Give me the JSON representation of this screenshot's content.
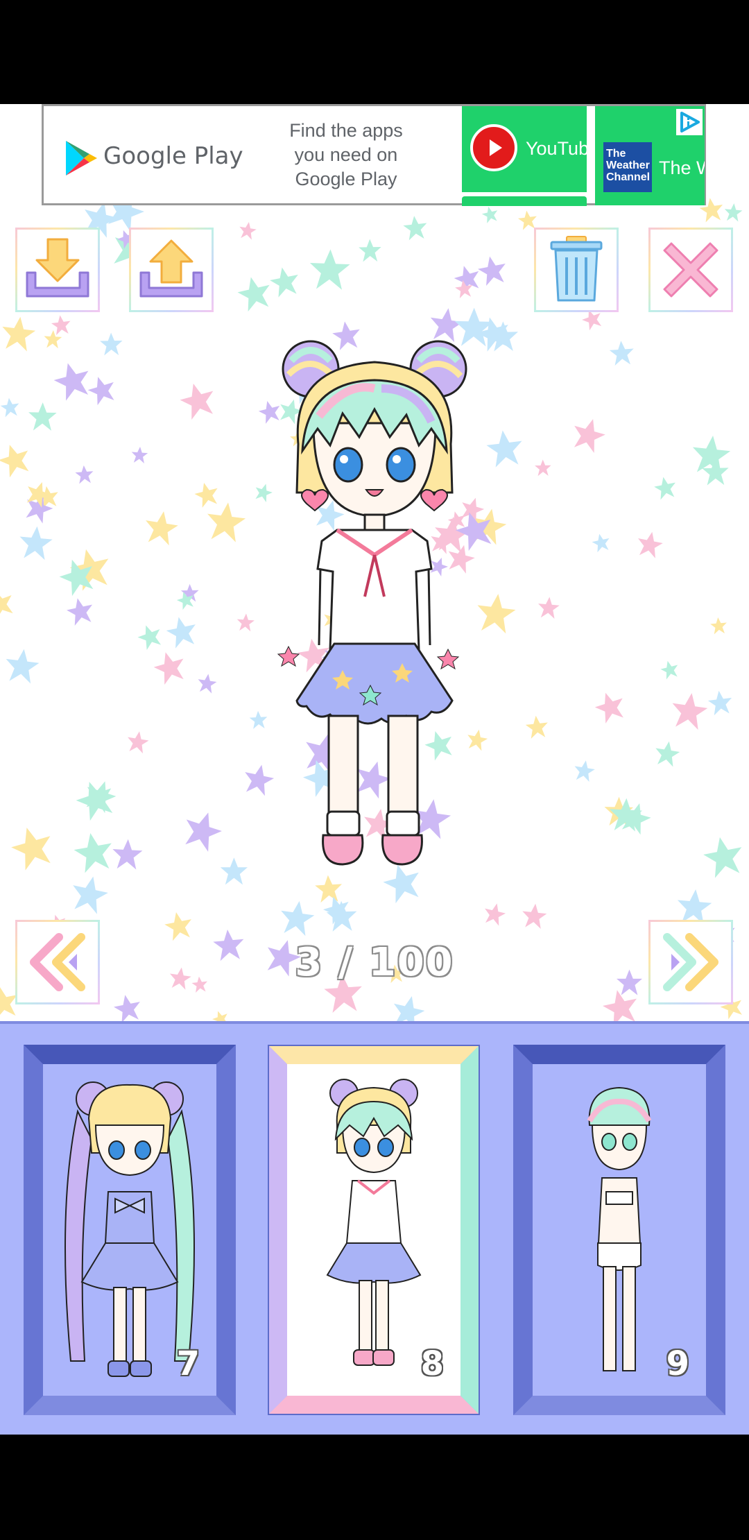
{
  "ad": {
    "brand": "Google Play",
    "copy": "Find the apps\nyou need on\nGoogle Play",
    "tile1_text": "YouTub",
    "tile2_logo": "The\nWeather\nChannel",
    "tile2_text": "The W",
    "icons": [
      "google-play-icon",
      "youtube-icon",
      "adchoices-icon"
    ]
  },
  "toolbar": {
    "download_icon": "download-icon",
    "upload_icon": "upload-icon",
    "trash_icon": "trash-icon",
    "close_icon": "close-icon"
  },
  "navigation": {
    "prev_icon": "double-chevron-left-icon",
    "next_icon": "double-chevron-right-icon",
    "counter": "3 / 100"
  },
  "slots": [
    {
      "number": "7",
      "selected": false,
      "style": "twin-tails-dress"
    },
    {
      "number": "8",
      "selected": true,
      "style": "sailor-uniform"
    },
    {
      "number": "9",
      "selected": false,
      "style": "base-doll"
    }
  ],
  "colors": {
    "selector_bg": "#abb5fb",
    "frame_dark": "#5d6cc9",
    "frame_light": "#8b97ea",
    "accent_pink": "#f7a8c8",
    "accent_yellow": "#fbd77a",
    "accent_purple": "#b7a0f0"
  }
}
